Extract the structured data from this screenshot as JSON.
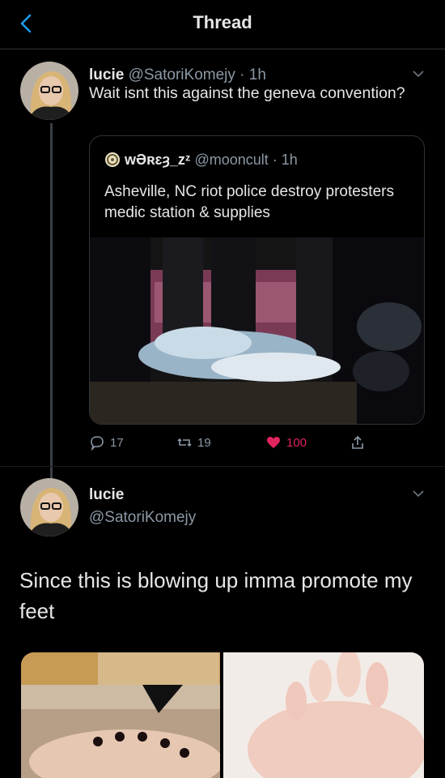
{
  "header": {
    "title": "Thread"
  },
  "tweet1": {
    "name": "lucie",
    "handle": "@SatoriKomejy",
    "sep": " · ",
    "time": "1h",
    "text": "Wait isnt this against the geneva convention?"
  },
  "quote": {
    "name": "wƏʀɛȝ_zᶻ",
    "handle": "@mooncult",
    "sep": " · ",
    "time": "1h",
    "text": "Asheville, NC riot police destroy protesters medic station & supplies"
  },
  "actions": {
    "replies": "17",
    "retweets": "19",
    "likes": "100"
  },
  "tweet2": {
    "name": "lucie",
    "handle": "@SatoriKomejy",
    "text": "Since this is blowing up imma promote my feet"
  },
  "colors": {
    "background": "#000000",
    "like": "#e0245e",
    "secondary_text": "#8b98a5",
    "divider": "#2f3336"
  }
}
